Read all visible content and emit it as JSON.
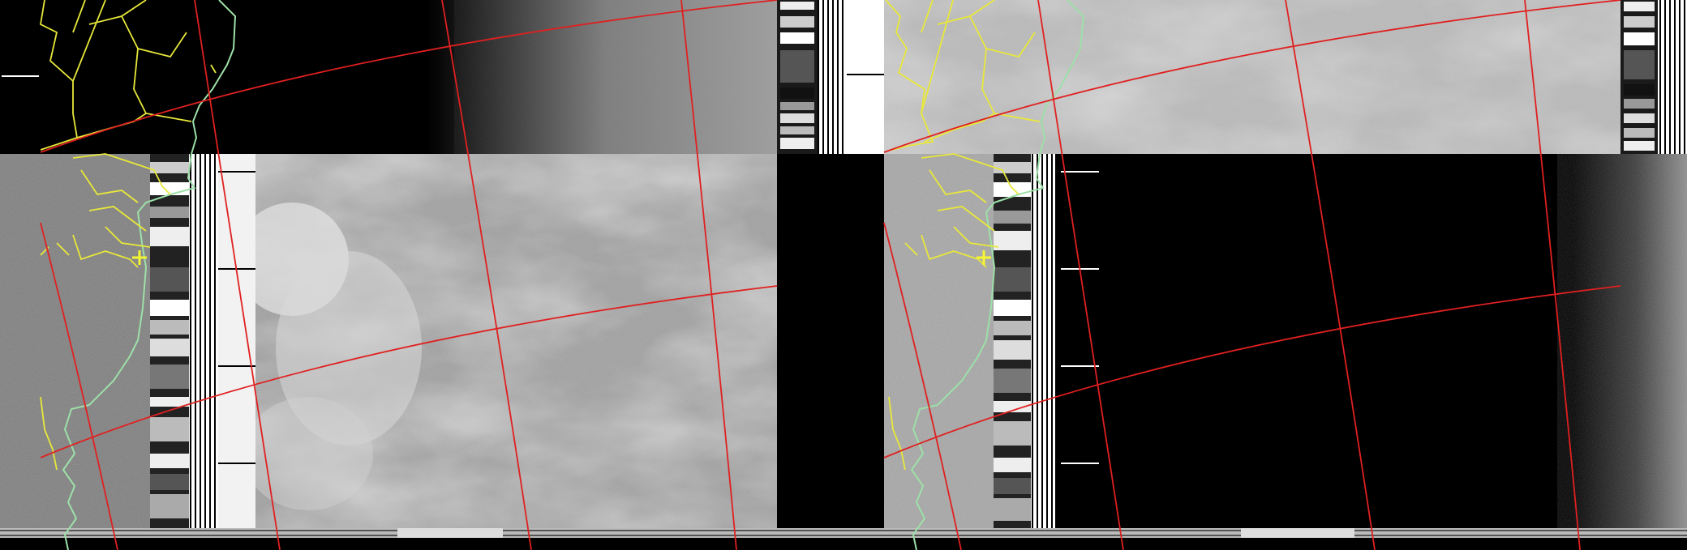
{
  "image": {
    "kind": "APT weather satellite image",
    "channels": [
      "visible-left",
      "infrared-right"
    ],
    "overlays": [
      "coastline",
      "province-borders",
      "lat-lon-grid",
      "location-marker"
    ]
  },
  "colors": {
    "background": "#000000",
    "grid_lines": "#e02020",
    "borders": "#e8e83a",
    "coastline": "#9de0a8",
    "marker": "#f5f534",
    "sync_white": "#ffffff"
  }
}
